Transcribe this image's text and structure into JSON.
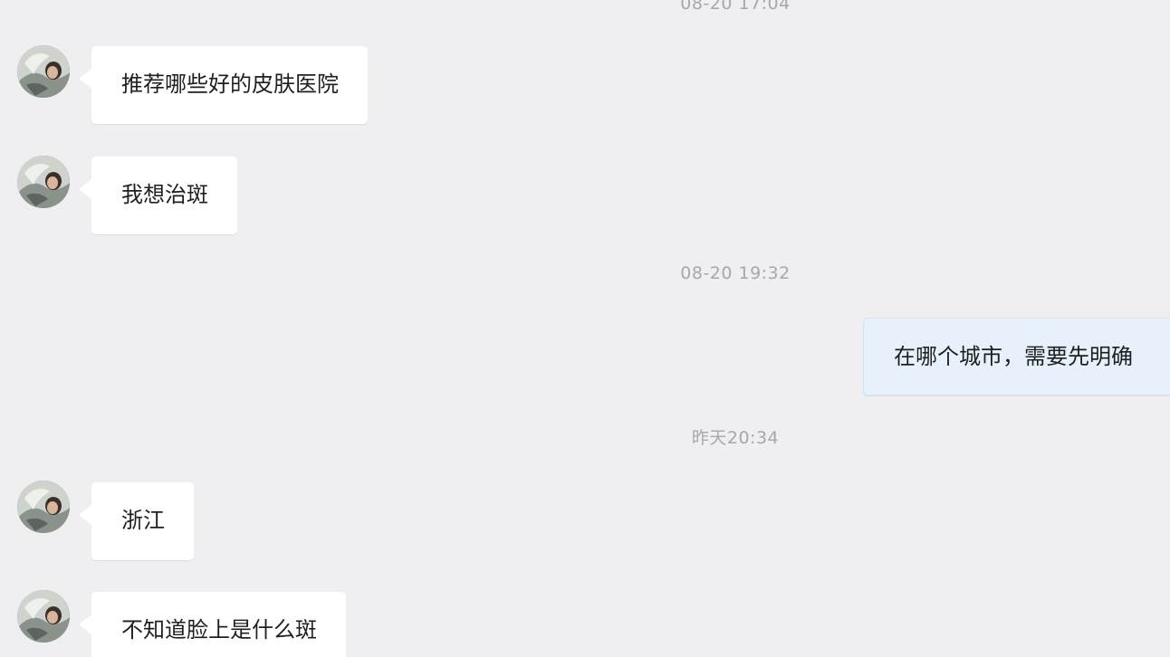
{
  "conversation": {
    "timestamps": {
      "first": "08-20 17:04",
      "second": "08-20 19:32",
      "third": "昨天20:34"
    },
    "messages": [
      {
        "sender": "user",
        "text": "推荐哪些好的皮肤医院"
      },
      {
        "sender": "user",
        "text": "我想治斑"
      },
      {
        "sender": "agent",
        "text": "在哪个城市，需要先明确"
      },
      {
        "sender": "user",
        "text": "浙江"
      },
      {
        "sender": "user",
        "text": "不知道脸上是什么斑"
      }
    ]
  },
  "colors": {
    "background": "#efeef0",
    "incoming_bubble": "#ffffff",
    "outgoing_bubble": "#e7f1fc",
    "timestamp_text": "#a6a8ad",
    "message_text": "#1f1f1f"
  },
  "icons": {
    "avatar": "user-avatar-photo"
  }
}
